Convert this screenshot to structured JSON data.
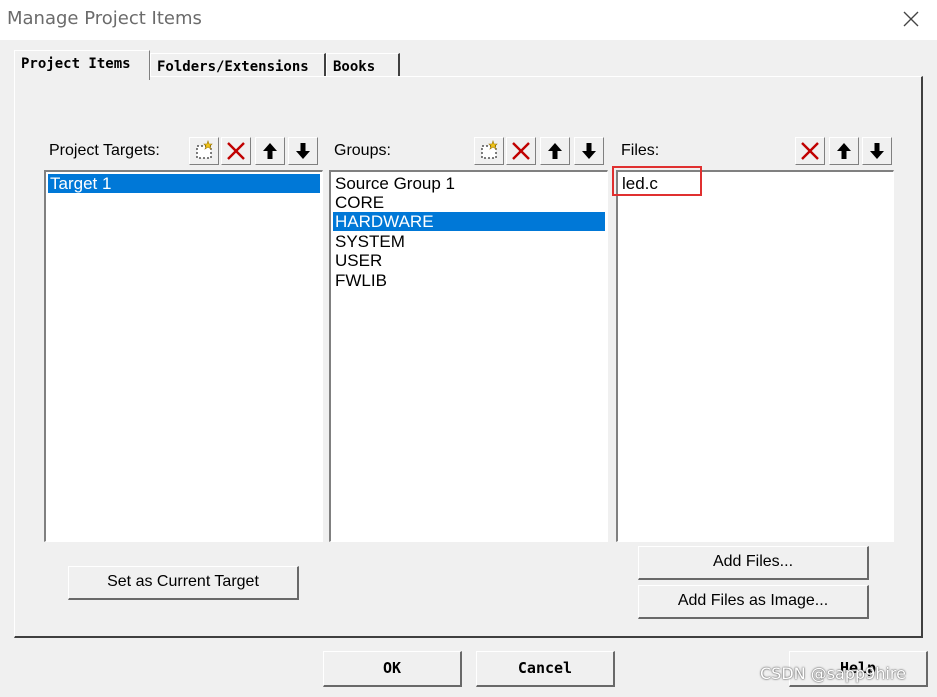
{
  "window": {
    "title": "Manage Project Items"
  },
  "tabs": [
    {
      "label": "Project Items",
      "active": true
    },
    {
      "label": "Folders/Extensions",
      "active": false
    },
    {
      "label": "Books",
      "active": false
    }
  ],
  "targets": {
    "label": "Project Targets:",
    "items": [
      {
        "text": "Target 1",
        "selected": true
      }
    ]
  },
  "groups": {
    "label": "Groups:",
    "items": [
      {
        "text": "Source Group 1",
        "selected": false
      },
      {
        "text": "CORE",
        "selected": false
      },
      {
        "text": "HARDWARE",
        "selected": true
      },
      {
        "text": "SYSTEM",
        "selected": false
      },
      {
        "text": "USER",
        "selected": false
      },
      {
        "text": "FWLIB",
        "selected": false
      }
    ]
  },
  "files": {
    "label": "Files:",
    "items": [
      {
        "text": "led.c",
        "selected": false
      }
    ]
  },
  "buttons": {
    "set_current_target": "Set as Current Target",
    "add_files": "Add Files...",
    "add_files_image": "Add Files as Image...",
    "ok": "OK",
    "cancel": "Cancel",
    "help": "Help"
  },
  "watermark": "CSDN @sapp9hire",
  "colors": {
    "selection": "#0078d7",
    "annotation": "#e03030",
    "delete_icon": "#c00000"
  },
  "icons": [
    "close-icon",
    "new-item-icon",
    "delete-icon",
    "move-up-icon",
    "move-down-icon"
  ]
}
